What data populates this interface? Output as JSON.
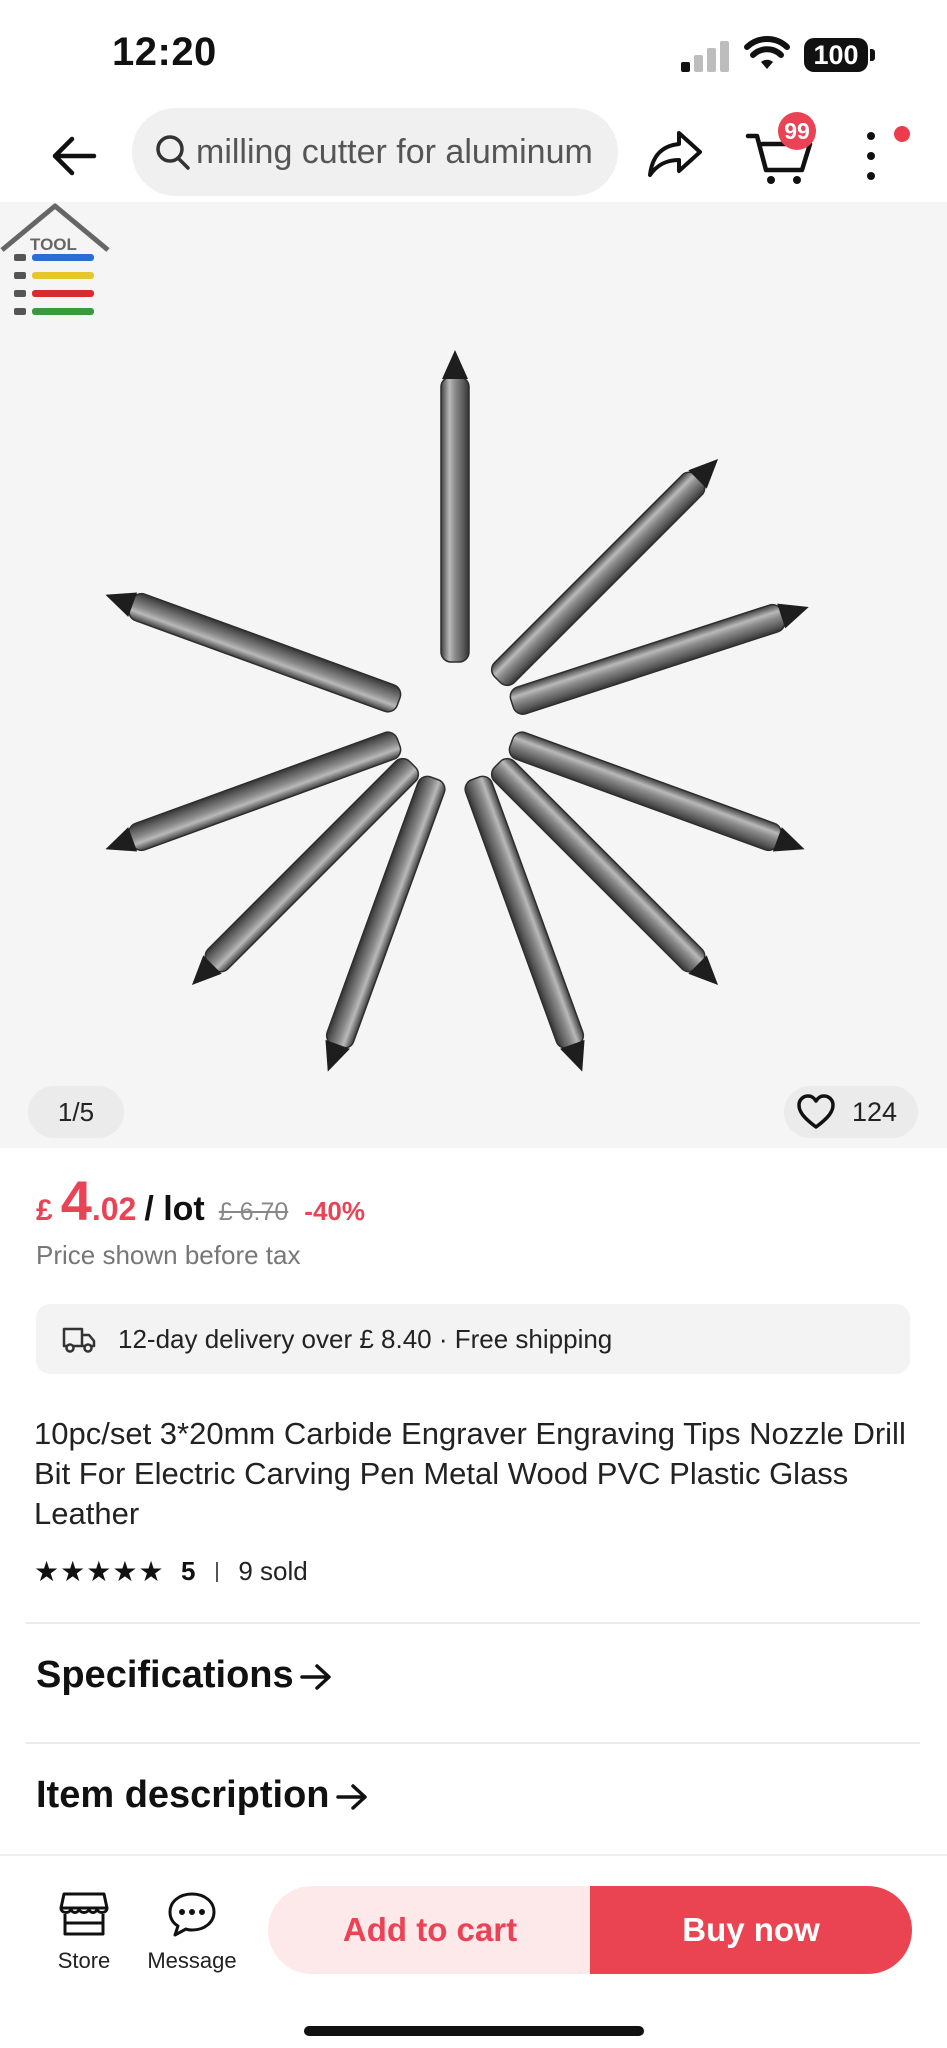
{
  "status_bar": {
    "time": "12:20",
    "battery": "100"
  },
  "top_nav": {
    "search_text": "milling cutter for aluminum",
    "cart_badge": "99"
  },
  "gallery": {
    "page_indicator": "1/5",
    "wishlist_count": "124",
    "logo_text": "TOOL"
  },
  "price": {
    "currency": "£",
    "integer": "4",
    "decimal": ".02",
    "unit": "/ lot",
    "original": "£ 6.70",
    "discount": "-40%",
    "tax_note": "Price shown before tax"
  },
  "delivery": {
    "text": "12-day delivery over  £ 8.40 · Free shipping"
  },
  "product": {
    "title": "10pc/set 3*20mm Carbide Engraver Engraving Tips Nozzle Drill Bit For Electric Carving Pen Metal Wood PVC Plastic Glass Leather",
    "rating": "5",
    "stars": 5,
    "sold": "9 sold"
  },
  "sections": {
    "specifications": "Specifications",
    "item_description": "Item description"
  },
  "bottom_bar": {
    "store_label": "Store",
    "message_label": "Message",
    "add_to_cart": "Add to cart",
    "buy_now": "Buy now"
  },
  "colors": {
    "accent": "#e94355",
    "buy_now_bg": "#ea4452",
    "add_cart_bg": "#fde8ea"
  }
}
